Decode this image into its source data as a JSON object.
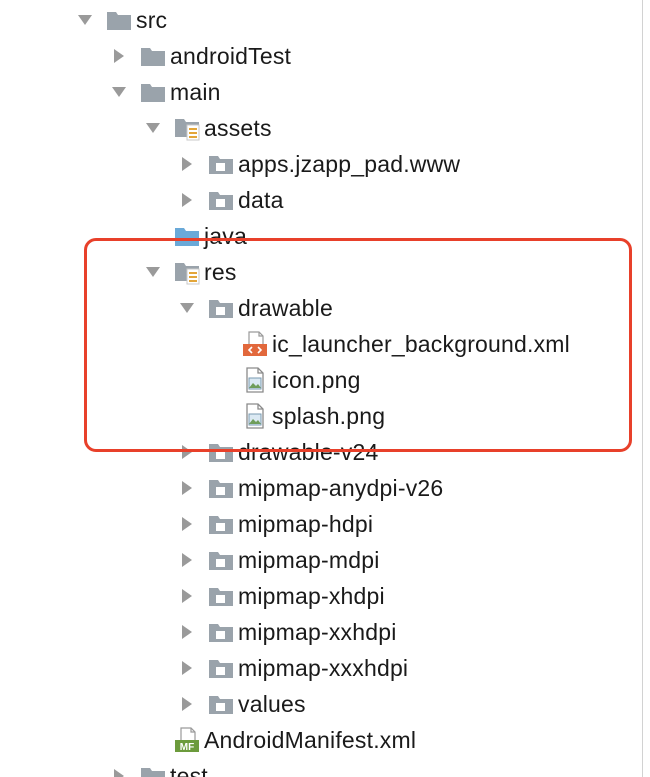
{
  "tree": {
    "rows": [
      {
        "label": "src",
        "depth": 0,
        "arrow": "down",
        "icon": "folder"
      },
      {
        "label": "androidTest",
        "depth": 1,
        "arrow": "right",
        "icon": "folder"
      },
      {
        "label": "main",
        "depth": 1,
        "arrow": "down",
        "icon": "folder"
      },
      {
        "label": "assets",
        "depth": 2,
        "arrow": "down",
        "icon": "resource-folder"
      },
      {
        "label": "apps.jzapp_pad.www",
        "depth": 3,
        "arrow": "right",
        "icon": "package-folder"
      },
      {
        "label": "data",
        "depth": 3,
        "arrow": "right",
        "icon": "package-folder"
      },
      {
        "label": "java",
        "depth": 2,
        "arrow": "none",
        "icon": "source-folder"
      },
      {
        "label": "res",
        "depth": 2,
        "arrow": "down",
        "icon": "resource-folder"
      },
      {
        "label": "drawable",
        "depth": 3,
        "arrow": "down",
        "icon": "package-folder"
      },
      {
        "label": "ic_launcher_background.xml",
        "depth": 4,
        "arrow": "none",
        "icon": "xml-file"
      },
      {
        "label": "icon.png",
        "depth": 4,
        "arrow": "none",
        "icon": "image-file"
      },
      {
        "label": "splash.png",
        "depth": 4,
        "arrow": "none",
        "icon": "image-file"
      },
      {
        "label": "drawable-v24",
        "depth": 3,
        "arrow": "right",
        "icon": "package-folder"
      },
      {
        "label": "mipmap-anydpi-v26",
        "depth": 3,
        "arrow": "right",
        "icon": "package-folder"
      },
      {
        "label": "mipmap-hdpi",
        "depth": 3,
        "arrow": "right",
        "icon": "package-folder"
      },
      {
        "label": "mipmap-mdpi",
        "depth": 3,
        "arrow": "right",
        "icon": "package-folder"
      },
      {
        "label": "mipmap-xhdpi",
        "depth": 3,
        "arrow": "right",
        "icon": "package-folder"
      },
      {
        "label": "mipmap-xxhdpi",
        "depth": 3,
        "arrow": "right",
        "icon": "package-folder"
      },
      {
        "label": "mipmap-xxxhdpi",
        "depth": 3,
        "arrow": "right",
        "icon": "package-folder"
      },
      {
        "label": "values",
        "depth": 3,
        "arrow": "right",
        "icon": "package-folder"
      },
      {
        "label": "AndroidManifest.xml",
        "depth": 2,
        "arrow": "none",
        "icon": "manifest-file"
      },
      {
        "label": "test",
        "depth": 1,
        "arrow": "right",
        "icon": "folder"
      }
    ]
  },
  "annotation": {
    "color": "#e8402a"
  },
  "colors": {
    "folder": "#9aa3ab",
    "source_folder": "#6aa9d8",
    "resource_stripes": "#e3a63a",
    "xml_badge": "#e2683c",
    "manifest_badge": "#6c9b3c",
    "arrow": "#9a9a9a"
  }
}
